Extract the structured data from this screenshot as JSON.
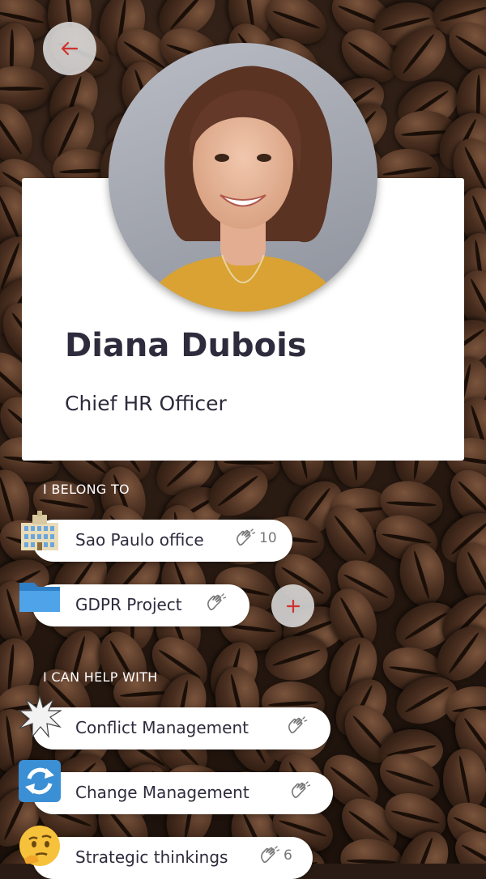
{
  "profile": {
    "name": "Diana Dubois",
    "role": "Chief HR Officer"
  },
  "colors": {
    "accent_red": "#d0312d",
    "text_dark": "#2d2b3c"
  },
  "belong": {
    "heading": "I BELONG TO",
    "items": [
      {
        "label": "Sao Paulo office",
        "count": "10",
        "icon": "office-building-icon"
      },
      {
        "label": "GDPR Project",
        "count": "",
        "icon": "folder-icon"
      }
    ],
    "add_icon": "plus-icon"
  },
  "help": {
    "heading": "I CAN HELP WITH",
    "items": [
      {
        "label": "Conflict Management",
        "count": "",
        "icon": "collision-icon"
      },
      {
        "label": "Change Management",
        "count": "",
        "icon": "refresh-arrows-icon"
      },
      {
        "label": "Strategic thinkings",
        "count": "6",
        "icon": "thinking-face-icon"
      }
    ]
  }
}
